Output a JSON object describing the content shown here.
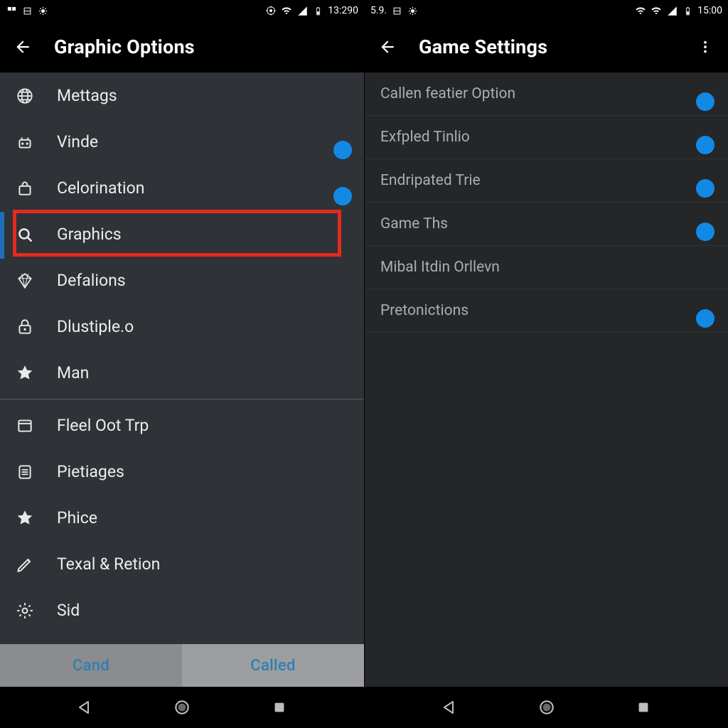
{
  "left": {
    "status": {
      "time": "13:290"
    },
    "appbar": {
      "title": "Graphic Options"
    },
    "items": [
      {
        "label": "Mettags",
        "icon": "globe",
        "toggle": null
      },
      {
        "label": "Vinde",
        "icon": "robot",
        "toggle": true
      },
      {
        "label": "Celorination",
        "icon": "package",
        "toggle": true
      },
      {
        "label": "Graphics",
        "icon": "search",
        "toggle": null,
        "highlight": true
      },
      {
        "label": "Defalions",
        "icon": "diamond",
        "toggle": null
      },
      {
        "label": "Dlustiple.o",
        "icon": "lock",
        "toggle": null
      },
      {
        "label": "Man",
        "icon": "star",
        "toggle": null
      }
    ],
    "items2": [
      {
        "label": "Fleel Oot Trp",
        "icon": "window"
      },
      {
        "label": "Pietiages",
        "icon": "list"
      },
      {
        "label": "Phice",
        "icon": "star"
      },
      {
        "label": "Texal & Retion",
        "icon": "pencil"
      },
      {
        "label": "Sid",
        "icon": "gear"
      }
    ],
    "actions": {
      "left": "Cand",
      "right": "Called"
    }
  },
  "right": {
    "status": {
      "left": "5.9.",
      "time": "15:00"
    },
    "appbar": {
      "title": "Game Settings"
    },
    "items": [
      {
        "label": "Callen featier Option",
        "toggle": true
      },
      {
        "label": "Exfpled Tinlio",
        "toggle": true
      },
      {
        "label": "Endripated Trie",
        "toggle": true
      },
      {
        "label": "Game Ths",
        "toggle": true
      },
      {
        "label": "Mibal Itdin Orllevn",
        "toggle": null
      },
      {
        "label": "Pretonictions",
        "toggle": true
      }
    ]
  }
}
